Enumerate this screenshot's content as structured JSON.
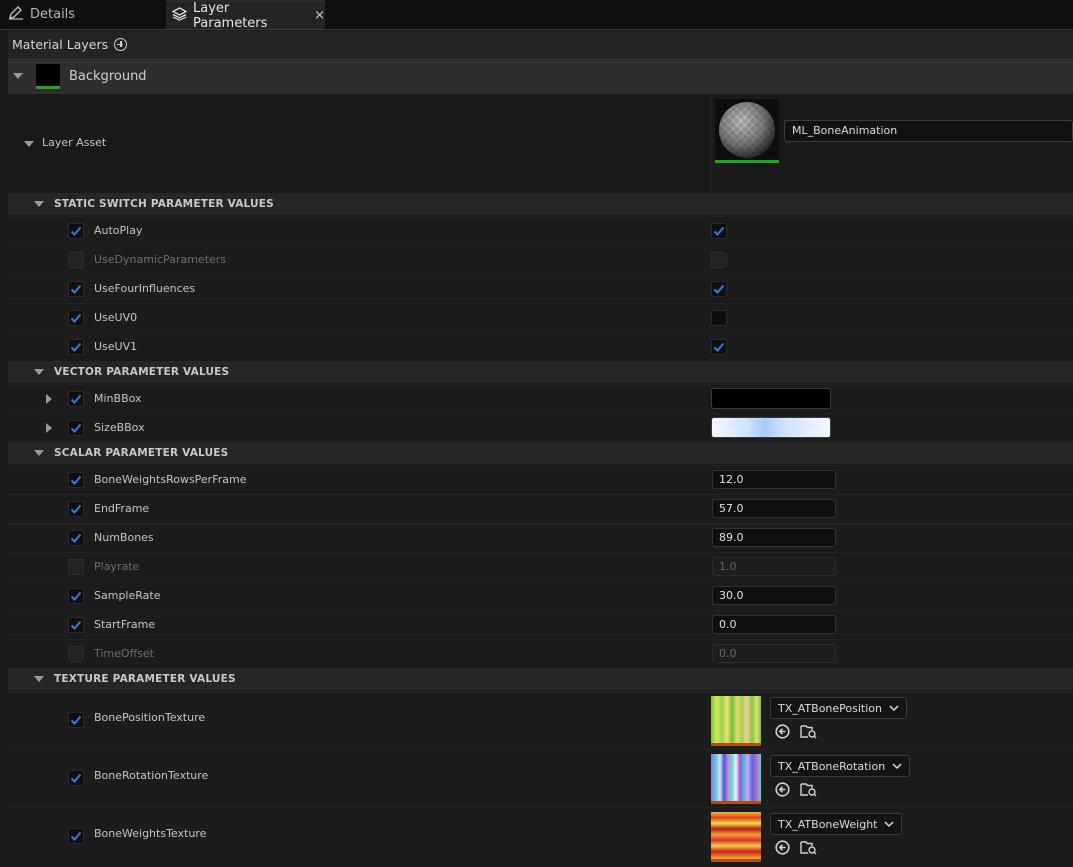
{
  "tabs": {
    "details": "Details",
    "layer_parameters": "Layer Parameters",
    "close_glyph": "×"
  },
  "material_layers": {
    "title": "Material Layers"
  },
  "background_layer": {
    "name": "Background"
  },
  "layer_asset": {
    "label": "Layer Asset",
    "value": "ML_BoneAnimation"
  },
  "sections": {
    "static": "STATIC SWITCH PARAMETER VALUES",
    "vector": "VECTOR PARAMETER VALUES",
    "scalar": "SCALAR PARAMETER VALUES",
    "texture": "TEXTURE PARAMETER VALUES"
  },
  "static_switch": [
    {
      "name": "AutoPlay",
      "enabled": true,
      "value": true
    },
    {
      "name": "UseDynamicParameters",
      "enabled": false,
      "value": false
    },
    {
      "name": "UseFourInfluences",
      "enabled": true,
      "value": true
    },
    {
      "name": "UseUV0",
      "enabled": true,
      "value": false
    },
    {
      "name": "UseUV1",
      "enabled": true,
      "value": true
    }
  ],
  "vector": [
    {
      "name": "MinBBox",
      "enabled": true,
      "color": "#000000"
    },
    {
      "name": "SizeBBox",
      "enabled": true,
      "color": "#dceaff"
    }
  ],
  "scalar": [
    {
      "name": "BoneWeightsRowsPerFrame",
      "enabled": true,
      "value": "12.0"
    },
    {
      "name": "EndFrame",
      "enabled": true,
      "value": "57.0"
    },
    {
      "name": "NumBones",
      "enabled": true,
      "value": "89.0"
    },
    {
      "name": "Playrate",
      "enabled": false,
      "value": "1.0"
    },
    {
      "name": "SampleRate",
      "enabled": true,
      "value": "30.0"
    },
    {
      "name": "StartFrame",
      "enabled": true,
      "value": "0.0"
    },
    {
      "name": "TimeOffset",
      "enabled": false,
      "value": "0.0"
    }
  ],
  "texture": [
    {
      "name": "BonePositionTexture",
      "enabled": true,
      "asset": "TX_ATBonePosition"
    },
    {
      "name": "BoneRotationTexture",
      "enabled": true,
      "asset": "TX_ATBoneRotation"
    },
    {
      "name": "BoneWeightsTexture",
      "enabled": true,
      "asset": "TX_ATBoneWeight"
    }
  ],
  "colors": {
    "checkbox_check": "#2f7de1",
    "accent_green": "#1fa51f"
  },
  "icons": {
    "details_tab": "pencil-icon",
    "layer_tab": "layers-icon",
    "use_selected": "arrow-left-circle-icon",
    "browse": "folder-search-icon"
  }
}
